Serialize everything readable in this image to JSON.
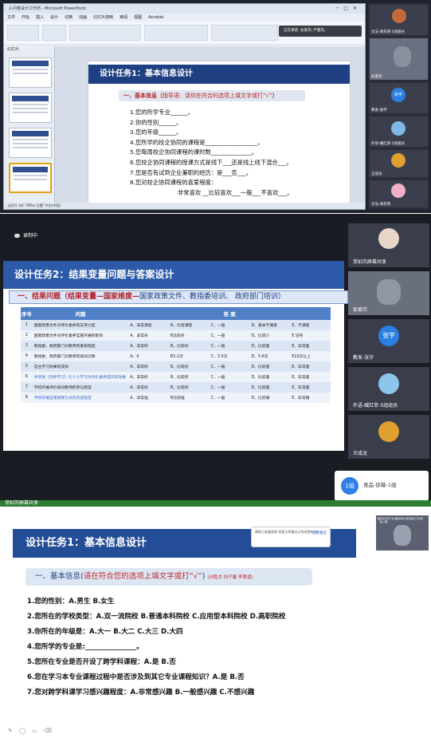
{
  "frame1": {
    "window_title": "2-问卷设计工作坊 - Microsoft PowerPoint",
    "ribbon_tabs": [
      "文件",
      "开始",
      "插入",
      "设计",
      "切换",
      "动画",
      "幻灯片放映",
      "审阅",
      "视图",
      "Acrobat"
    ],
    "thumbs_tab": "幻灯片",
    "notice": "正在讲话: 俞爱宗; 严墨先;",
    "status_text": "幻灯片 4/4   \"Office 主题\"   中文(中国)",
    "slide": {
      "title": "设计任务1：基本信息设计",
      "band_red": "一、基本信息（",
      "band_blue": "指导语：请你在符合的选项上填文字或打“√”",
      "band_end": "）",
      "items": [
        "1.您的所学专业______。",
        "2.你的性别______。",
        "3.您的年级______。",
        "4.您所学的校企协同的课程是__________________。",
        "5.您每周校企协同课程的课时数______________。",
        "6.您校企协同课程的授课方式是线下___还是线上线下混合___。",
        "7.您是否有试到企业兼职的经历：是___否___。",
        "8.您对校企协同课程的喜爱程度：",
        "非常喜欢 __比较喜欢___一般___不喜欢___。"
      ]
    },
    "participants": [
      {
        "name": "文法-阅氏燕-5组组长"
      },
      {
        "name": "俞爱宗"
      },
      {
        "name": "教发-张宇",
        "avatar_text": "张宇"
      },
      {
        "name": "外语-臧红菲-5组组员"
      },
      {
        "name": "王成龙"
      },
      {
        "name": "文法-阅氏燕"
      }
    ]
  },
  "frame2": {
    "recording_label": "录制中",
    "slide": {
      "title": "设计任务2：结果变量问题与答案设计",
      "sub_bold": "一、结果问题（结果变量—国家维度—",
      "sub_rest": "国家政策文件、教指委培训、 政府部门培训）",
      "col_num": "序号",
      "col_question": "问题",
      "col_answer": "答  案",
      "rows": [
        {
          "n": "1",
          "q": "国家政策文件对评价素养的支持力度",
          "a": [
            "A、非常满意",
            "B、比较满意",
            "C、一般",
            "D、基本不满意",
            "E、不满意"
          ]
        },
        {
          "n": "2",
          "q": "国家政策文件对评价素养实施开展的影响",
          "a": [
            "A、非常多",
            "B比较多",
            "C、一般",
            "D、比较少",
            "E 没有"
          ]
        },
        {
          "n": "3",
          "q": "教指委、政府部门对教师的重视程度",
          "a": [
            "A、非常好",
            "B、比较好",
            "C、一般",
            "D、比较差",
            "E、非常差"
          ]
        },
        {
          "n": "4",
          "q": "教指委、政府部门对教师的培训次数",
          "a": [
            "A、0",
            "B1-2次",
            "C、3-5次",
            "D、5-8次",
            "E10次以上"
          ]
        },
        {
          "n": "5",
          "q": "自主学习效果的成效",
          "a": [
            "A、非常好",
            "B、比较好",
            "C、一般",
            "D、比较差",
            "E、非常差"
          ]
        },
        {
          "n": "6",
          "q": "共同体（同伴学习）比个人学习对评价素养提升的效果",
          "a": [
            "A、非常好",
            "B、比较好",
            "C、一般",
            "D、比较差",
            "E、非常差"
          ]
        },
        {
          "n": "7",
          "q": "学校开展评价培训教师的参与程度",
          "a": [
            "A、非常好",
            "B、比较好",
            "C、一般",
            "D、比较差",
            "E、非常差"
          ]
        },
        {
          "n": "8",
          "q": "学校开展互相观摩方式的欢迎程度",
          "a": [
            "A、非常强",
            "B比较强",
            "C、一般",
            "D、比较弱",
            "E、非常弱"
          ]
        }
      ]
    },
    "participants": [
      {
        "name": "常虹的屏幕共享"
      },
      {
        "name": "俞爱宗"
      },
      {
        "name": "教发-张宇",
        "avatar_text": "张宇"
      },
      {
        "name": "外语-臧红菲-5组组员"
      },
      {
        "name": "王成龙"
      }
    ],
    "group_badge": "1组",
    "group_label": "食品-徐薇-1组",
    "share_bar": "常虹的屏幕共享"
  },
  "frame3": {
    "slide": {
      "title": "设计任务1：基本信息设计",
      "band_a": "一、基本信息(",
      "band_red": "请在符合您的选项上填文字或打“√”",
      "band_b": ")",
      "band_names": "(孙胜杰 刘子馨 李翠遗)",
      "items": [
        "1.您的性别：A.男生     B.女生",
        "2.您所在的学校类型：A.双一流院校  B.普通本科院校  C.应用型本科院校  D.高职院校",
        "3.你所在的年级是：A.大一   B.大二   C.大三  D.大四",
        "4.您所学的专业是:_______________。",
        "5.您所在专业是否开设了跨学科课程：A.是     B.否",
        "6.您在学习本专业课程过程中是否涉及到其它专业课程知识？A.是     B.否",
        "7.您对跨学科课学习感兴趣程度：A.非常感兴趣     B.一般感兴趣   C.不感兴趣"
      ]
    },
    "popup_text": "最新已准备就绪 您要立即重启以完成更新吗？",
    "popup_action": "立即重启",
    "video_caption": "数智化背景下外语教师评价素养提升工作坊（第二期）"
  },
  "colors": {
    "slide_title_blue": "#1e3f82",
    "accent_red": "#c0272d",
    "table_header_blue": "#4f7fc6",
    "share_green": "#2e7d32"
  }
}
